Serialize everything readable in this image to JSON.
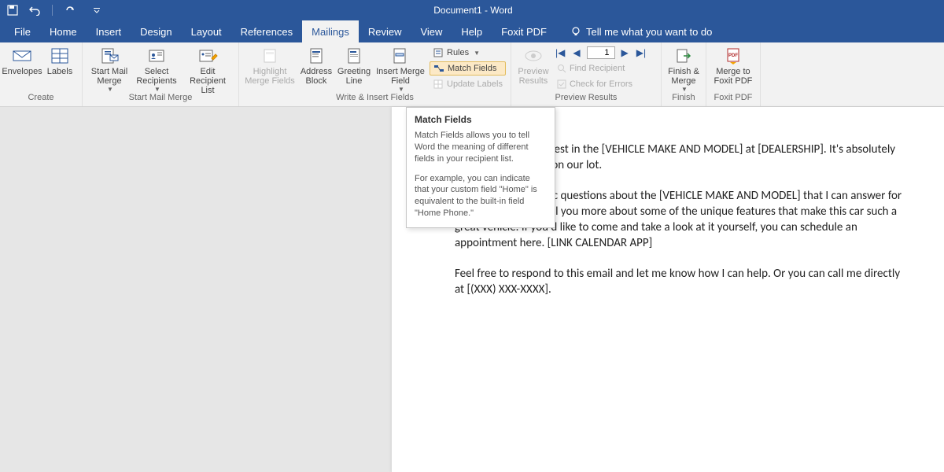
{
  "title": "Document1  -  Word",
  "tabs": {
    "file": "File",
    "home": "Home",
    "insert": "Insert",
    "design": "Design",
    "layout": "Layout",
    "references": "References",
    "mailings": "Mailings",
    "review": "Review",
    "view": "View",
    "help": "Help",
    "foxit": "Foxit PDF",
    "tellme": "Tell me what you want to do"
  },
  "ribbon": {
    "create": {
      "envelopes": "Envelopes",
      "labels": "Labels",
      "group": "Create"
    },
    "start": {
      "startmerge": "Start Mail\nMerge",
      "select": "Select\nRecipients",
      "edit": "Edit\nRecipient List",
      "group": "Start Mail Merge"
    },
    "write": {
      "highlight": "Highlight\nMerge Fields",
      "address": "Address\nBlock",
      "greeting": "Greeting\nLine",
      "insertf": "Insert Merge\nField",
      "rules": "Rules",
      "match": "Match Fields",
      "update": "Update Labels",
      "group": "Write & Insert Fields"
    },
    "preview": {
      "preview": "Preview\nResults",
      "record": "1",
      "find": "Find Recipient",
      "check": "Check for Errors",
      "group": "Preview Results"
    },
    "finish": {
      "finish": "Finish &\nMerge",
      "mergepdf": "Merge to\nFoxit PDF",
      "group1": "Finish",
      "group2": "Foxit PDF"
    }
  },
  "tooltip": {
    "title": "Match Fields",
    "p1": "Match Fields allows you to tell Word the meaning of different fields in your recipient list.",
    "p2": "For example, you can indicate that your custom field \"Home\" is equivalent to the built-in field \"Home Phone.\""
  },
  "document": {
    "p1": "Thanks for your interest in the [VEHICLE MAKE AND MODEL] at [DEALERSHIP]. It's absolutely one of the best cars on our lot.",
    "p2": "Are there any specific questions about the [VEHICLE MAKE AND MODEL] that I can answer for you? I'm happy to tell you more about some of the unique features that make this car such a great vehicle. If you'd like to come and take a look at it yourself, you can schedule an appointment here. [LINK CALENDAR APP]",
    "p3": "Feel free to respond to this email and let me know how I can help. Or you can call me directly at [(XXX) XXX-XXXX]."
  }
}
